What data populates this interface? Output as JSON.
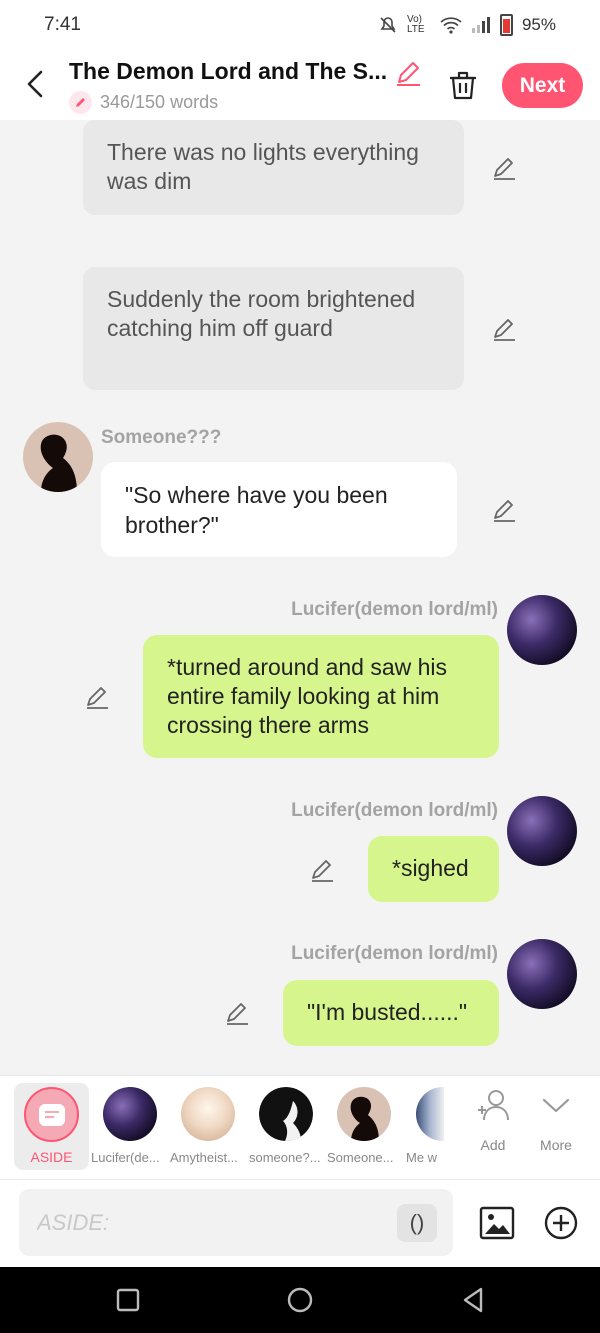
{
  "status_bar": {
    "time": "7:41",
    "network": "Vo) LTE",
    "battery": "95%"
  },
  "header": {
    "title": "The Demon Lord and The S...",
    "word_count": "346/150 words",
    "next_label": "Next",
    "icons": [
      "back-arrow-icon",
      "pencil-icon",
      "trash-icon"
    ]
  },
  "messages": [
    {
      "type": "narration",
      "text": "There was no lights everything was dim"
    },
    {
      "type": "narration",
      "text": "Suddenly the room brightened catching him off guard"
    },
    {
      "type": "left",
      "speaker": "Someone???",
      "text": "\"So where have you been brother?\""
    },
    {
      "type": "right",
      "speaker": "Lucifer(demon lord/ml)",
      "text": "*turned around and saw his entire family looking at him crossing there arms"
    },
    {
      "type": "right",
      "speaker": "Lucifer(demon lord/ml)",
      "text": "*sighed"
    },
    {
      "type": "right",
      "speaker": "Lucifer(demon lord/ml)",
      "text": "\"I'm busted......\""
    }
  ],
  "characters": {
    "aside_label": "ASIDE",
    "items": [
      "Lucifer(de...",
      "Amytheist...",
      "someone?...",
      "Someone...",
      "Me w"
    ],
    "add_label": "Add",
    "more_label": "More"
  },
  "input": {
    "placeholder": "ASIDE:",
    "paren_label": "()"
  },
  "colors": {
    "accent": "#ff5573",
    "green_bubble": "#d7f58d",
    "narration_bg": "#e8e8e8"
  }
}
